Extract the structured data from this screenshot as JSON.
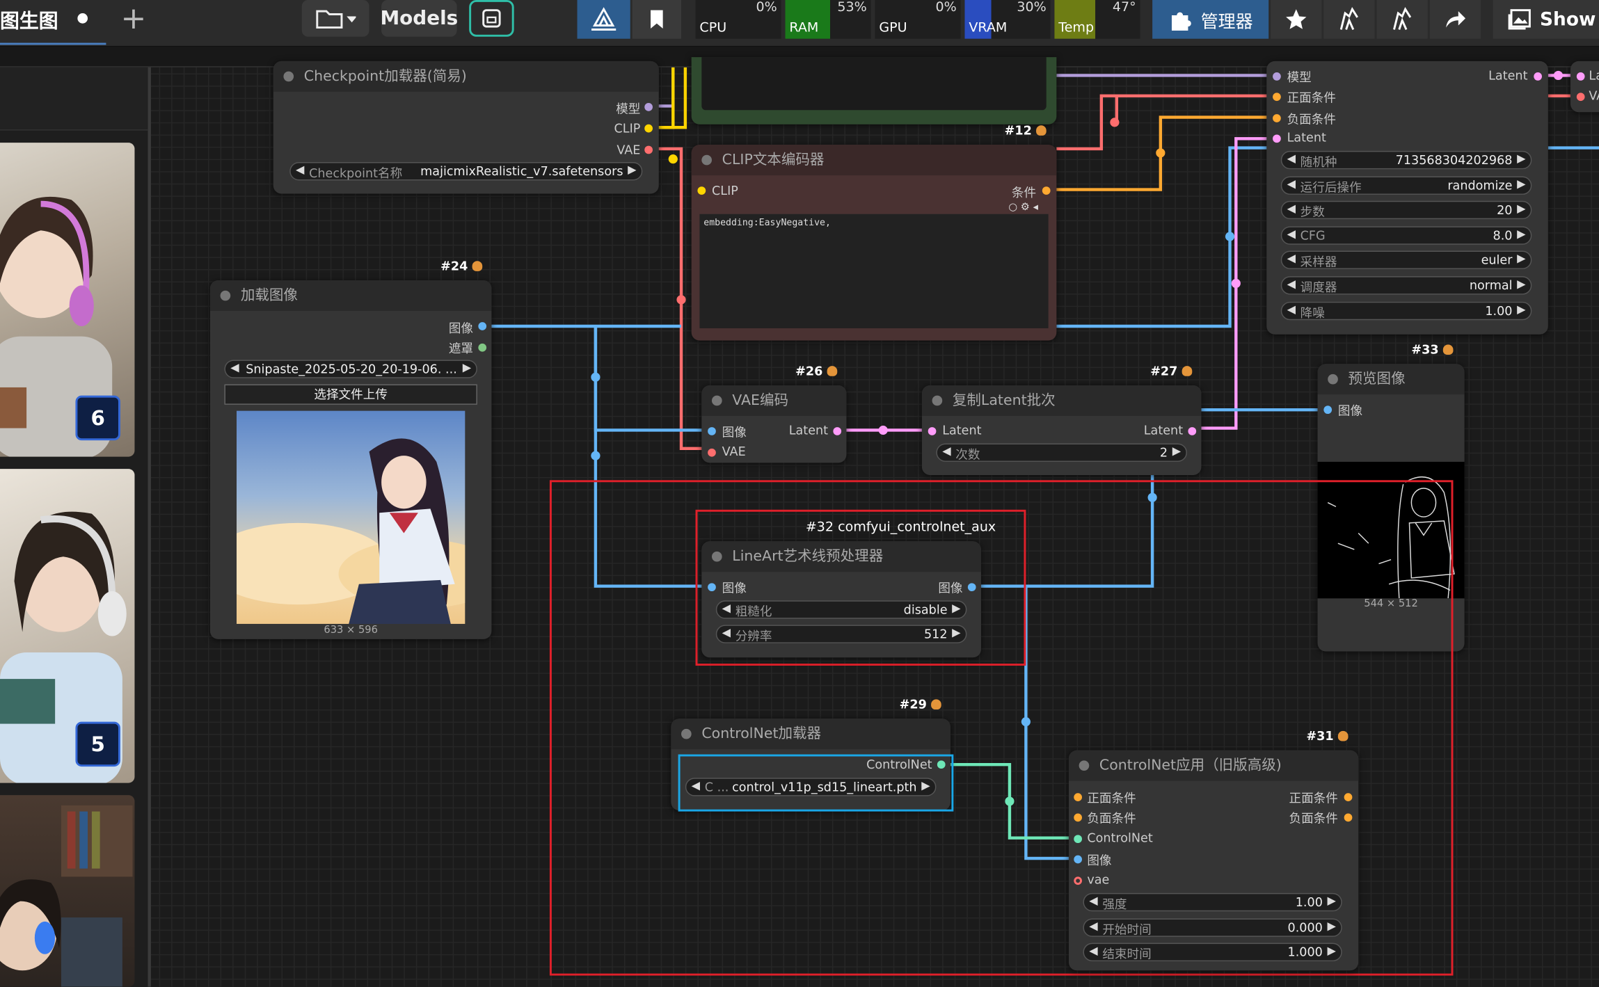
{
  "topbar": {
    "tab_title": "图生图",
    "models_label": "Models",
    "manager_label": "管理器",
    "show_label": "Show I",
    "cpu": {
      "label": "CPU",
      "value": "0%"
    },
    "ram": {
      "label": "RAM",
      "value": "53%"
    },
    "gpu": {
      "label": "GPU",
      "value": "0%"
    },
    "vram": {
      "label": "VRAM",
      "value": "30%"
    },
    "temp": {
      "label": "Temp",
      "value": "47°"
    }
  },
  "sidebar": {
    "badges": [
      "6",
      "5"
    ]
  },
  "nodes": {
    "checkpoint": {
      "title": "Checkpoint加载器(简易)",
      "out_model": "模型",
      "out_clip": "CLIP",
      "out_vae": "VAE",
      "w_label": "Checkpoint名称",
      "w_value": "majicmixRealistic_v7.safetensors"
    },
    "clip_encoder": {
      "id": "#12",
      "title": "CLIP文本编码器",
      "in_clip": "CLIP",
      "out_cond": "条件",
      "text": "embedding:EasyNegative,"
    },
    "load_image": {
      "id": "#24",
      "title": "加载图像",
      "out_image": "图像",
      "out_mask": "遮罩",
      "w_value": "Snipaste_2025-05-20_20-19-06. ...",
      "upload": "选择文件上传",
      "size": "633 × 596"
    },
    "vae_encode": {
      "id": "#26",
      "title": "VAE编码",
      "in_image": "图像",
      "in_vae": "VAE",
      "out_latent": "Latent"
    },
    "repeat_latent": {
      "id": "#27",
      "title": "复制Latent批次",
      "in_latent": "Latent",
      "out_latent": "Latent",
      "w_label": "次数",
      "w_value": "2"
    },
    "ksampler": {
      "in_model": "模型",
      "in_pos": "正面条件",
      "in_neg": "负面条件",
      "in_latent": "Latent",
      "out_latent": "Latent",
      "widgets": [
        {
          "label": "随机种",
          "value": "713568304202968"
        },
        {
          "label": "运行后操作",
          "value": "randomize"
        },
        {
          "label": "步数",
          "value": "20"
        },
        {
          "label": "CFG",
          "value": "8.0"
        },
        {
          "label": "采样器",
          "value": "euler"
        },
        {
          "label": "调度器",
          "value": "normal"
        },
        {
          "label": "降噪",
          "value": "1.00"
        }
      ]
    },
    "edge_right": {
      "l1": "La",
      "l2": "VA"
    },
    "preview": {
      "id": "#33",
      "title": "预览图像",
      "in_image": "图像",
      "size": "544 × 512"
    },
    "lineart": {
      "id": "#32 comfyui_controlnet_aux",
      "title": "LineArt艺术线预处理器",
      "in_image": "图像",
      "out_image": "图像",
      "w1_label": "粗糙化",
      "w1_value": "disable",
      "w2_label": "分辨率",
      "w2_value": "512"
    },
    "cn_loader": {
      "id": "#29",
      "title": "ControlNet加载器",
      "out": "ControlNet",
      "w_label": "C ...",
      "w_value": "control_v11p_sd15_lineart.pth"
    },
    "cn_apply": {
      "id": "#31",
      "title": "ControlNet应用（旧版高级)",
      "in_pos": "正面条件",
      "in_neg": "负面条件",
      "in_cn": "ControlNet",
      "in_image": "图像",
      "in_vae": "vae",
      "out_pos": "正面条件",
      "out_neg": "负面条件",
      "widgets": [
        {
          "label": "强度",
          "value": "1.00"
        },
        {
          "label": "开始时间",
          "value": "0.000"
        },
        {
          "label": "结束时间",
          "value": "1.000"
        }
      ]
    }
  },
  "colors": {
    "model": "#b39ddb",
    "clip": "#ffd500",
    "vae": "#ff6e6e",
    "cond": "#ffa931",
    "latent": "#ff9cf9",
    "image": "#64b5f6",
    "mask": "#81c784",
    "controlnet": "#6ee7b7",
    "highlight_red": "#e0202a",
    "highlight_blue": "#1aa7e8"
  }
}
